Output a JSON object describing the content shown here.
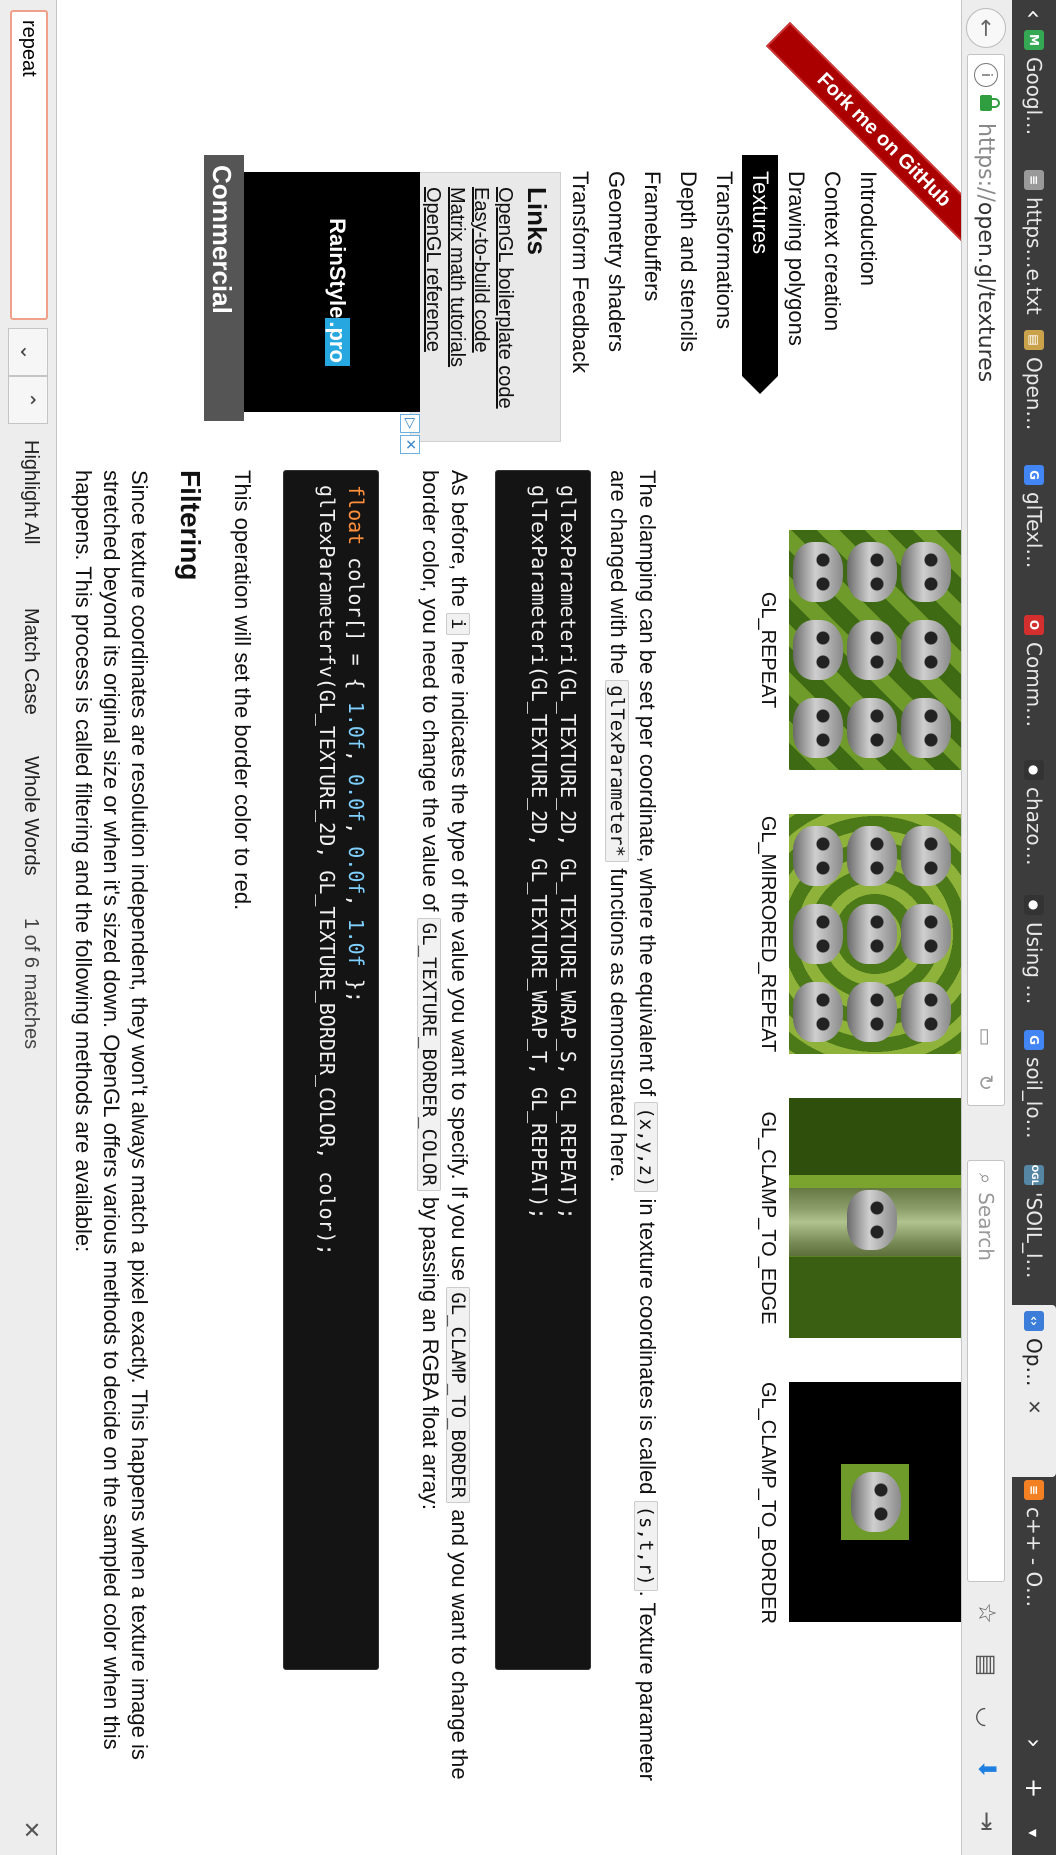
{
  "tabs": [
    {
      "label": "Googl…",
      "icon": "google-maps-icon",
      "color": "#34a853"
    },
    {
      "label": "https…e.txt",
      "icon": "document-icon",
      "color": "#9a9a9a"
    },
    {
      "label": "Open…",
      "icon": "book-icon",
      "color": "#c9a24a"
    },
    {
      "label": "glTexl…",
      "icon": "google-icon",
      "color": "#4285f4"
    },
    {
      "label": "Comm…",
      "icon": "opera-icon",
      "color": "#d32f2f"
    },
    {
      "label": "chazo…",
      "icon": "github-icon",
      "color": "#333333"
    },
    {
      "label": "Using …",
      "icon": "github-icon",
      "color": "#333333"
    },
    {
      "label": "soil_lo…",
      "icon": "google-icon",
      "color": "#4285f4"
    },
    {
      "label": "'SOIL_l…",
      "icon": "opengl-icon",
      "color": "#5586a4"
    },
    {
      "label": "Op…",
      "icon": "open-gl-icon",
      "color": "#3b7dd8",
      "active": true
    },
    {
      "label": "c++ - O…",
      "icon": "stackoverflow-icon",
      "color": "#f48024"
    }
  ],
  "nav": {
    "url_scheme": "https://",
    "url_host": "open.gl/textures",
    "search_placeholder": "Search"
  },
  "ribbon": {
    "label": "Fork me on GitHub",
    "color": "#aa0000"
  },
  "sidebar": {
    "items": [
      {
        "label": "Introduction"
      },
      {
        "label": "Context creation"
      },
      {
        "label": "Drawing polygons"
      },
      {
        "label": "Textures",
        "active": true
      },
      {
        "label": "Transformations"
      },
      {
        "label": "Depth and stencils"
      },
      {
        "label": "Framebuffers"
      },
      {
        "label": "Geometry shaders"
      },
      {
        "label": "Transform Feedback"
      }
    ],
    "links_title": "Links",
    "links": [
      "OpenGL boilerplate code",
      "Easy-to-build code",
      "Matrix math tutorials",
      "OpenGL reference"
    ],
    "ad_brand": "RainStyle",
    "ad_brand_suffix": ".pro",
    "commercial_label": "Commercial"
  },
  "wrap_demos": [
    {
      "label": "GL_REPEAT",
      "style": "repeat"
    },
    {
      "label": "GL_MIRRORED_REPEAT",
      "style": "mirror"
    },
    {
      "label": "GL_CLAMP_TO_EDGE",
      "style": "edge"
    },
    {
      "label": "GL_CLAMP_TO_BORDER",
      "style": "border"
    }
  ],
  "content": {
    "p1_a": "The clamping can be set per coordinate, where the equivalent of",
    "p1_code1": "(x,y,z)",
    "p1_b": "in texture coordinates is called",
    "p1_code2": "(s,t,r)",
    "p1_c": ". Texture parameter are changed with the",
    "p1_code3": "glTexParameter*",
    "p1_d": "functions as demonstrated here.",
    "code1_line1": "glTexParameteri(GL_TEXTURE_2D, GL_TEXTURE_WRAP_S, GL_REPEAT);",
    "code1_line2": "glTexParameteri(GL_TEXTURE_2D, GL_TEXTURE_WRAP_T, GL_REPEAT);",
    "p2_a": "As before, the",
    "p2_code1": "i",
    "p2_b": "here indicates the type of the value you want to specify. If you use",
    "p2_code2": "GL_CLAMP_TO_BORDER",
    "p2_c": "and you want to change the border color, you need to change the value of",
    "p2_code3": "GL_TEXTURE_BORDER_COLOR",
    "p2_d": "by passing an RGBA float array:",
    "code2_kw": "float",
    "code2_a": " color[] = { ",
    "code2_n1": "1.0f",
    "code2_n2": "0.0f",
    "code2_n3": "0.0f",
    "code2_n4": "1.0f",
    "code2_line2": "glTexParameterfv(GL_TEXTURE_2D, GL_TEXTURE_BORDER_COLOR, color);",
    "p3": "This operation will set the border color to red.",
    "h_filtering": "Filtering",
    "p4": "Since texture coordinates are resolution independent, they won't always match a pixel exactly. This happens when a texture image is stretched beyond its original size or when it's sized down. OpenGL offers various methods to decide on the sampled color when this happens. This process is called filtering and the following methods are available:"
  },
  "findbar": {
    "query": "repeat",
    "highlight_all": "Highlight All",
    "match_case": "Match Case",
    "whole_words": "Whole Words",
    "matches": "1 of 6 matches"
  }
}
